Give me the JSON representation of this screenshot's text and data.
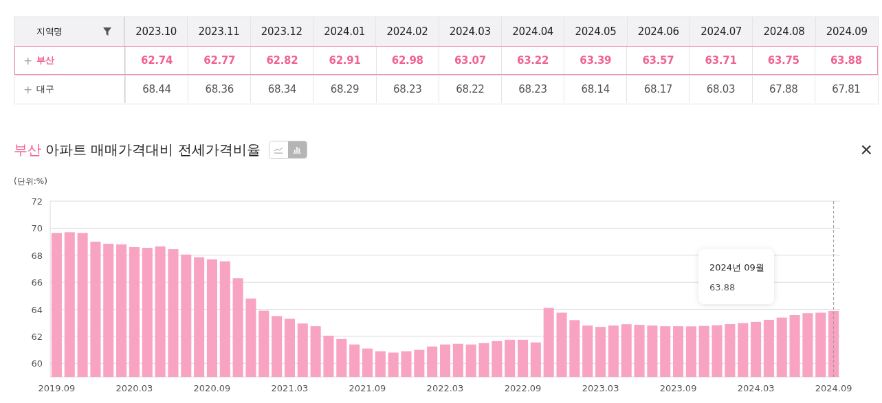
{
  "table": {
    "columns": [
      "지역명",
      "2023.10",
      "2023.11",
      "2023.12",
      "2024.01",
      "2024.02",
      "2024.03",
      "2024.04",
      "2024.05",
      "2024.06",
      "2024.07",
      "2024.08",
      "2024.09"
    ],
    "rows": [
      {
        "name": "부산",
        "selected": true,
        "expander": "+",
        "values": [
          "62.74",
          "62.77",
          "62.82",
          "62.91",
          "62.98",
          "63.07",
          "63.22",
          "63.39",
          "63.57",
          "63.71",
          "63.75",
          "63.88"
        ]
      },
      {
        "name": "대구",
        "selected": false,
        "expander": "+",
        "values": [
          "68.44",
          "68.36",
          "68.34",
          "68.29",
          "68.23",
          "68.22",
          "68.23",
          "68.14",
          "68.17",
          "68.03",
          "67.88",
          "67.81"
        ]
      }
    ]
  },
  "chart_panel": {
    "region": "부산",
    "title": "아파트 매매가격대비 전세가격비율",
    "views": [
      {
        "kind": "line",
        "selected": false
      },
      {
        "kind": "bar",
        "selected": true
      }
    ],
    "unit": "(단위:%)",
    "tooltip": {
      "title": "2024년 09월",
      "value": "63.88"
    },
    "chart_data": {
      "type": "bar",
      "ylim": [
        59,
        72
      ],
      "yticks": [
        60,
        62,
        64,
        66,
        68,
        70,
        72
      ],
      "grid": true,
      "categories": [
        "2019.09",
        null,
        null,
        null,
        null,
        null,
        "2020.03",
        null,
        null,
        null,
        null,
        null,
        "2020.09",
        null,
        null,
        null,
        null,
        null,
        "2021.03",
        null,
        null,
        null,
        null,
        null,
        "2021.09",
        null,
        null,
        null,
        null,
        null,
        "2022.03",
        null,
        null,
        null,
        null,
        null,
        "2022.09",
        null,
        null,
        null,
        null,
        null,
        "2023.03",
        null,
        null,
        null,
        null,
        null,
        "2023.09",
        null,
        null,
        null,
        null,
        null,
        "2024.03",
        null,
        null,
        null,
        null,
        null,
        "2024.09"
      ],
      "series": [
        {
          "color": "#f8a3c2",
          "values": [
            69.65,
            69.7,
            69.65,
            69.0,
            68.85,
            68.8,
            68.6,
            68.55,
            68.65,
            68.45,
            68.05,
            67.85,
            67.7,
            67.55,
            66.3,
            64.8,
            63.9,
            63.5,
            63.3,
            62.95,
            62.75,
            62.05,
            61.8,
            61.4,
            61.1,
            60.9,
            60.8,
            60.9,
            61.0,
            61.25,
            61.4,
            61.45,
            61.4,
            61.5,
            61.65,
            61.75,
            61.75,
            61.55,
            64.1,
            63.75,
            63.2,
            62.8,
            62.7,
            62.8,
            62.9,
            62.85,
            62.8,
            62.75,
            62.75,
            62.74,
            62.77,
            62.82,
            62.91,
            62.98,
            63.07,
            63.22,
            63.39,
            63.57,
            63.71,
            63.75,
            63.88
          ]
        }
      ]
    }
  },
  "close_button": {
    "label": "×"
  }
}
